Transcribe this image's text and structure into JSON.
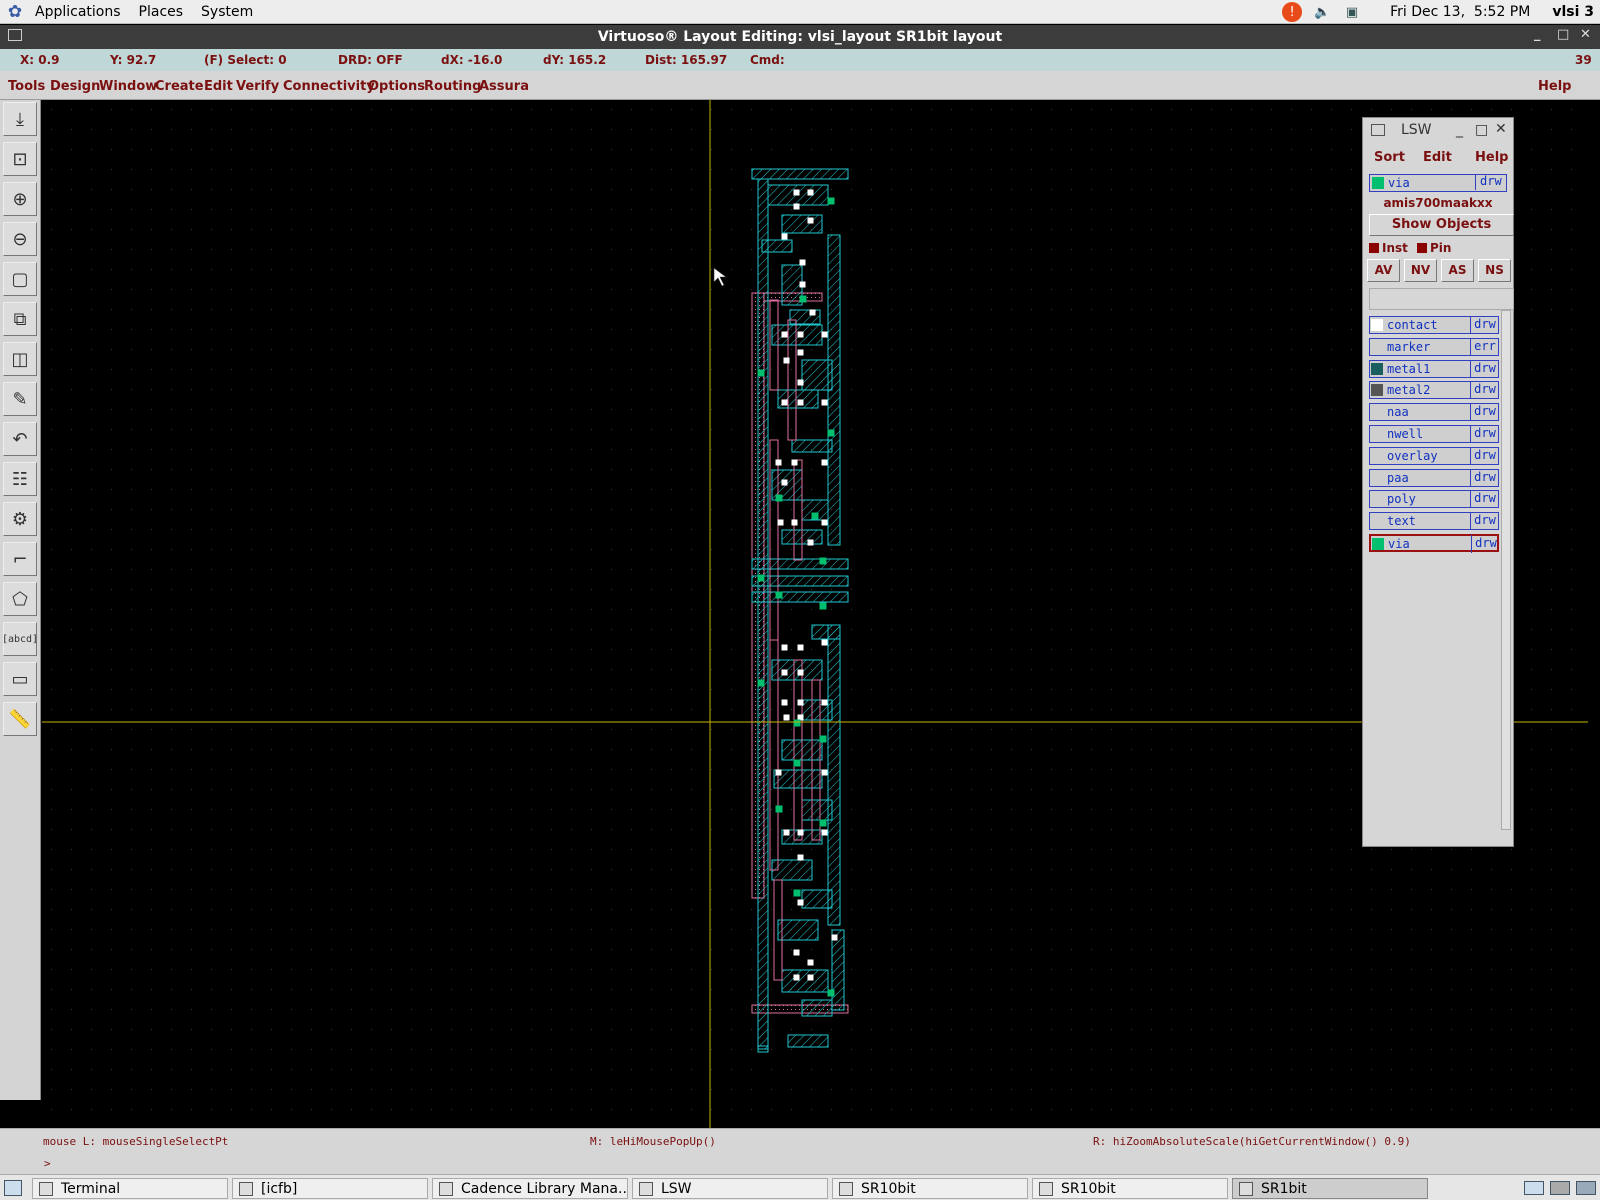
{
  "topbar": {
    "menus": [
      "Applications",
      "Places",
      "System"
    ],
    "clock": "Fri Dec 13,  5:52 PM",
    "user": "vlsi 3",
    "icons": [
      "update-alert-icon",
      "volume-icon",
      "network-icon"
    ]
  },
  "window": {
    "title": "Virtuoso® Layout Editing: vlsi_layout SR1bit layout"
  },
  "status": {
    "x": "X: 0.9",
    "y": "Y: 92.7",
    "select": "(F) Select: 0",
    "drd": "DRD: OFF",
    "dx": "dX: -16.0",
    "dy": "dY: 165.2",
    "dist": "Dist: 165.97",
    "cmd": "Cmd:",
    "counter": "39"
  },
  "menubar": {
    "items": [
      "Tools",
      "Design",
      "Window",
      "Create",
      "Edit",
      "Verify",
      "Connectivity",
      "Options",
      "Routing",
      "Assura"
    ],
    "help": "Help"
  },
  "toolbar": {
    "icons": [
      "save-icon",
      "fit-view-icon",
      "zoom-in-icon",
      "zoom-out-icon",
      "stretch-icon",
      "copy-icon",
      "move-icon",
      "delete-icon",
      "undo-icon",
      "property-icon",
      "instance-icon",
      "path-icon",
      "polygon-icon",
      "label-icon",
      "rectangle-icon",
      "ruler-icon"
    ],
    "label_tool_text": "[abcd]"
  },
  "lsw": {
    "title": "LSW",
    "menus": [
      "Sort",
      "Edit",
      "Help"
    ],
    "selected": {
      "name": "via",
      "purpose": "drw",
      "color": "#00c070"
    },
    "tech": "amis700maakxx",
    "show_objects": "Show Objects",
    "checks": [
      "Inst",
      "Pin"
    ],
    "filter_buttons": [
      "AV",
      "NV",
      "AS",
      "NS"
    ],
    "layers": [
      {
        "name": "contact",
        "purpose": "drw",
        "color": "#ffffff"
      },
      {
        "name": "marker",
        "purpose": "err",
        "color": ""
      },
      {
        "name": "metal1",
        "purpose": "drw",
        "color": "#1a6060"
      },
      {
        "name": "metal2",
        "purpose": "drw",
        "color": "#555555"
      },
      {
        "name": "naa",
        "purpose": "drw",
        "color": ""
      },
      {
        "name": "nwell",
        "purpose": "drw",
        "color": ""
      },
      {
        "name": "overlay",
        "purpose": "drw",
        "color": ""
      },
      {
        "name": "paa",
        "purpose": "drw",
        "color": ""
      },
      {
        "name": "poly",
        "purpose": "drw",
        "color": ""
      },
      {
        "name": "text",
        "purpose": "drw",
        "color": ""
      },
      {
        "name": "via",
        "purpose": "drw",
        "color": "#00c070",
        "active": true
      }
    ]
  },
  "cmdline": {
    "left": "mouse L: mouseSingleSelectPt",
    "middle": "M: leHiMousePopUp()",
    "right": "R: hiZoomAbsoluteScale(hiGetCurrentWindow() 0.9)",
    "prompt": ">"
  },
  "taskbar": {
    "tasks": [
      "Terminal",
      "[icfb]",
      "Cadence Library Mana...",
      "LSW",
      "SR10bit",
      "SR10bit",
      "SR1bit"
    ],
    "active": "SR1bit"
  },
  "colors": {
    "metal1": "#20c8d0",
    "poly": "#e070a0",
    "via": "#00c070",
    "contact": "#ffffff",
    "crosshair": "#c8b400"
  }
}
